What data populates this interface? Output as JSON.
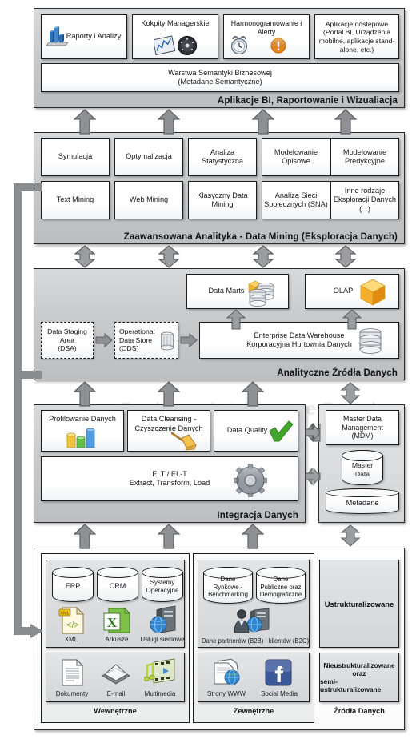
{
  "watermark": {
    "line1": "Business Intelligence Portal",
    "line2": "Business Intelligence Portal",
    "line3": "Business Intelligence Portal",
    "big": "BI Portal"
  },
  "layers": [
    {
      "id": "bi-apps",
      "title": "Aplikacje BI, Raportowanie i Wizualiacja",
      "cards": [
        {
          "label": "Raporty i Analizy",
          "icon": "bar-chart-icon"
        },
        {
          "label": "Kokpity Managerskie",
          "icon": "dashboard-gauge-icon"
        },
        {
          "label": "Harmonogramowanie i Alerty",
          "icon": "alarm-clock-alert-icon"
        },
        {
          "label": "Aplikacje dostępowe (Portal BI, Urządzenia mobilne, aplikacje stand-alone, etc.)",
          "icon": "none"
        }
      ],
      "semantic_layer": "Warstwa Semantyki Biznesowej\n(Metadane Semantyczne)",
      "semantic_line1": "Warstwa Semantyki Biznesowej",
      "semantic_line2": "(Metadane Semantyczne)"
    },
    {
      "id": "advanced-analytics",
      "title": "Zaawansowana Analityka - Data Mining (Eksploracja Danych)",
      "row1": [
        {
          "label": "Symulacja"
        },
        {
          "label": "Optymalizacja"
        },
        {
          "label": "Analiza Statystyczna"
        },
        {
          "label": "Modelowanie Opisowe"
        },
        {
          "label": "Modelowanie Predykcyjne"
        }
      ],
      "row2": [
        {
          "label": "Text Mining"
        },
        {
          "label": "Web Mining"
        },
        {
          "label": "Klasyczny Data Mining"
        },
        {
          "label": "Analiza Sieci Społecznych (SNA)"
        },
        {
          "label": "Inne rodzaje Eksploracji Danych (...)"
        }
      ]
    },
    {
      "id": "analytical-sources",
      "title": "Analityczne Źródła Danych",
      "data_marts": {
        "label": "Data Marts",
        "icon": "cube-database-stack-icon"
      },
      "olap": {
        "label": "OLAP",
        "icon": "orange-cube-icon"
      },
      "dsa": {
        "label": "Data Staging Area\n(DSA)",
        "line1": "Data Staging",
        "line2": "Area",
        "line3": "(DSA)"
      },
      "ods": {
        "label": "Operational Data Store\n(ODS)",
        "line1": "Operational",
        "line2": "Data Store",
        "line3": "(ODS)",
        "icon": "database-icon"
      },
      "edw": {
        "line1": "Enterprise Data Warehouse",
        "line2": "Korporacyjna Hurtownia Danych",
        "icon": "database-stack-icon"
      }
    },
    {
      "id": "data-integration",
      "title": "Integracja Danych",
      "cards": [
        {
          "label": "Profilowanie Danych",
          "icon": "colored-bars-icon"
        },
        {
          "label": "Data Cleansing - Czyszczenie Danych",
          "icon": "broom-icon"
        },
        {
          "label": "Data Quality",
          "icon": "green-check-icon"
        }
      ],
      "etl": {
        "line1": "ELT / EL-T",
        "line2": "Extract, Transform, Load",
        "icon": "gear-icon"
      },
      "mdm_panel": {
        "mdm": {
          "line1": "Master Data",
          "line2": "Management",
          "line3": "(MDM)"
        },
        "master_data": {
          "line1": "Master",
          "line2": "Data"
        },
        "metadata": {
          "label": "Metadane"
        }
      }
    },
    {
      "id": "data-sources",
      "title": "Źródła Danych",
      "internal_label": "Wewnętrzne",
      "external_label": "Zewnętrzne",
      "structured_label": "Ustrukturalizowane",
      "unstructured_label": "Nieustrukturalizowane oraz semi-ustrukturalizowane",
      "unstructured_line1": "Nieustrukturalizowane",
      "unstructured_line2": "oraz",
      "unstructured_line3": "semi-ustrukturalizowane",
      "internal_structured": {
        "cylinders": [
          {
            "label": "ERP"
          },
          {
            "label": "CRM"
          },
          {
            "label": "Systemy Operacyjne",
            "line1": "Systemy",
            "line2": "Operacyjne"
          }
        ],
        "icons": [
          {
            "label": "XML",
            "icon": "xml-file-icon"
          },
          {
            "label": "Arkusze",
            "icon": "spreadsheet-icon"
          },
          {
            "label": "Usługi sieciowe",
            "icon": "web-service-icon"
          }
        ]
      },
      "external_structured": {
        "cylinders": [
          {
            "label": "Dane Rynkowe - Benchmarking",
            "line1": "Dane",
            "line2": "Rynkowe -",
            "line3": "Benchmarking"
          },
          {
            "label": "Dane Publiczne oraz Demograficzne",
            "line1": "Dane",
            "line2": "Publiczne oraz",
            "line3": "Demograficzne"
          }
        ],
        "icons": [
          {
            "label": "Dane partnerów (B2B) i klientów (B2C)",
            "icon": "partners-server-icon"
          }
        ]
      },
      "internal_unstructured": {
        "icons": [
          {
            "label": "Dokumenty",
            "icon": "document-icon"
          },
          {
            "label": "E-mail",
            "icon": "envelope-icon"
          },
          {
            "label": "Multimedia",
            "icon": "multimedia-icon"
          }
        ]
      },
      "external_unstructured": {
        "icons": [
          {
            "label": "Strony WWW",
            "icon": "web-page-globe-icon"
          },
          {
            "label": "Social Media",
            "icon": "facebook-social-icon"
          }
        ]
      }
    }
  ],
  "colors": {
    "layer_bg": "#cfd0d2",
    "arrow": "#8a8c8f",
    "border": "#1d1d1d",
    "title_text": "#111111",
    "orange_accent": "#f08b1b",
    "green_check": "#41a62a"
  }
}
